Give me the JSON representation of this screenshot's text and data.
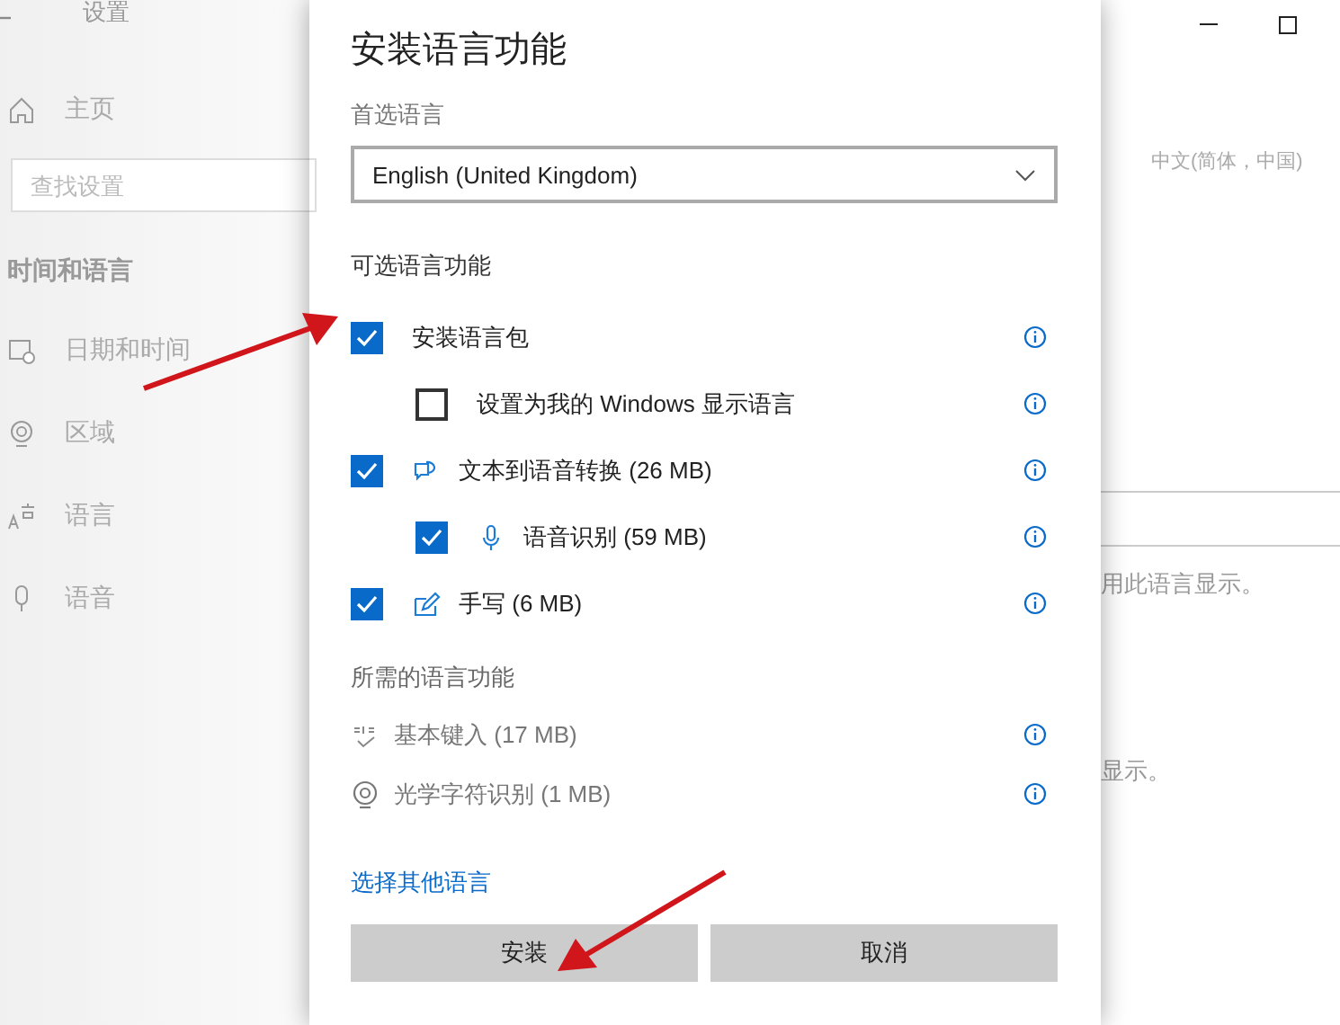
{
  "settings_window": {
    "title": "设置",
    "home": "主页",
    "search": {
      "placeholder": "查找设置"
    },
    "section": "时间和语言",
    "nav": [
      {
        "label": "日期和时间",
        "kind": "clock"
      },
      {
        "label": "区域",
        "kind": "globe"
      },
      {
        "label": "语言",
        "kind": "lang"
      },
      {
        "label": "语音",
        "kind": "mic"
      }
    ],
    "current_language": "中文(简体，中国)",
    "text_1": "用此语言显示。",
    "text_2": "显示。"
  },
  "dialog": {
    "title": "安装语言功能",
    "preferred_label": "首选语言",
    "preferred_value": "English (United Kingdom)",
    "optional_label": "可选语言功能",
    "features": [
      {
        "label": "安装语言包",
        "kind": "plain",
        "checked": true,
        "children": [
          {
            "label": "设置为我的 Windows 显示语言",
            "kind": "plain",
            "checked": false
          }
        ]
      },
      {
        "label": "文本到语音转换 (26 MB)",
        "kind": "tts",
        "checked": true,
        "children": [
          {
            "label": "语音识别 (59 MB)",
            "kind": "mic",
            "checked": true
          }
        ]
      },
      {
        "label": "手写 (6 MB)",
        "kind": "pen",
        "checked": true
      }
    ],
    "required_label": "所需的语言功能",
    "required": [
      {
        "label": "基本键入 (17 MB)",
        "kind": "abc"
      },
      {
        "label": "光学字符识别 (1 MB)",
        "kind": "ocr"
      }
    ],
    "link": "选择其他语言",
    "buttons": [
      "安装",
      "取消"
    ]
  }
}
